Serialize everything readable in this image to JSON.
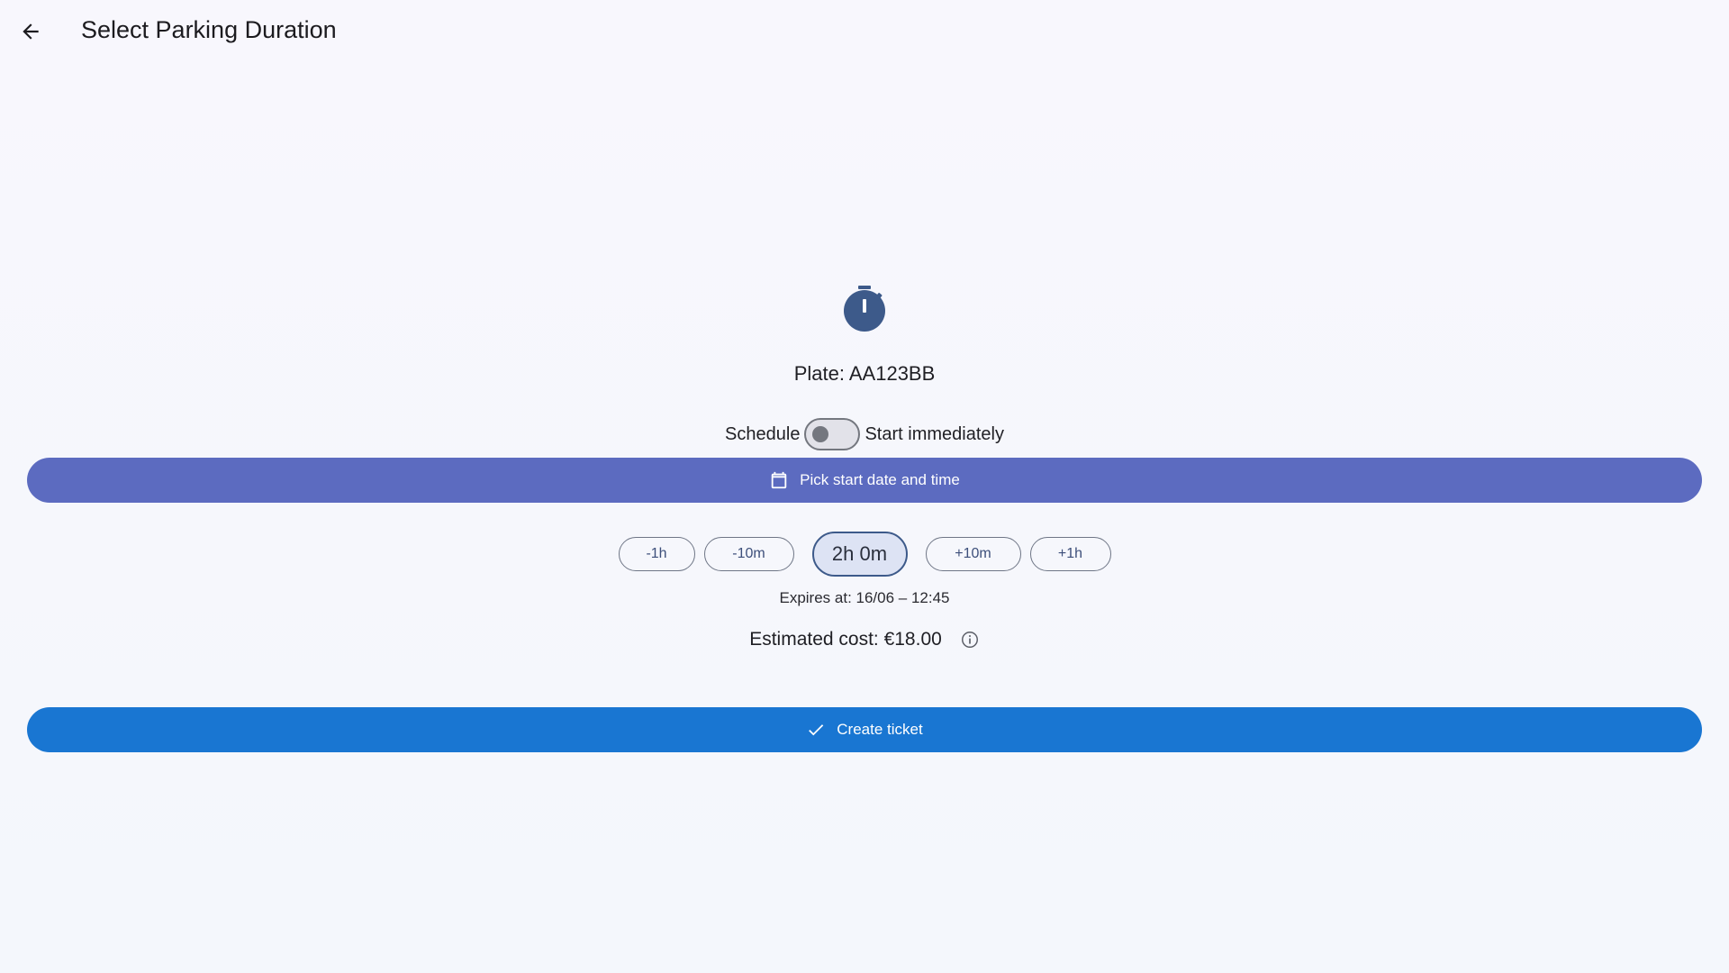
{
  "header": {
    "title": "Select Parking Duration",
    "back_icon": "arrow-back-icon"
  },
  "main": {
    "timer_icon": "timer-icon",
    "plate_label": "Plate: AA123BB",
    "schedule": {
      "left_label": "Schedule",
      "right_label": "Start immediately",
      "toggle_on": false
    },
    "pick_button": {
      "label": "Pick start date and time",
      "icon": "calendar-icon"
    },
    "adjusters": {
      "minus_1h": "-1h",
      "minus_10m": "-10m",
      "duration": "2h 0m",
      "plus_10m": "+10m",
      "plus_1h": "+1h"
    },
    "expires_text": "Expires at: 16/06 – 12:45",
    "cost_text": "Estimated cost: €18.00",
    "info_icon": "info-icon",
    "create_button": {
      "label": "Create ticket",
      "icon": "check-icon"
    }
  },
  "colors": {
    "pick_button": "#5c6bc0",
    "create_button": "#1976d2",
    "timer_icon": "#3d5a8a"
  }
}
